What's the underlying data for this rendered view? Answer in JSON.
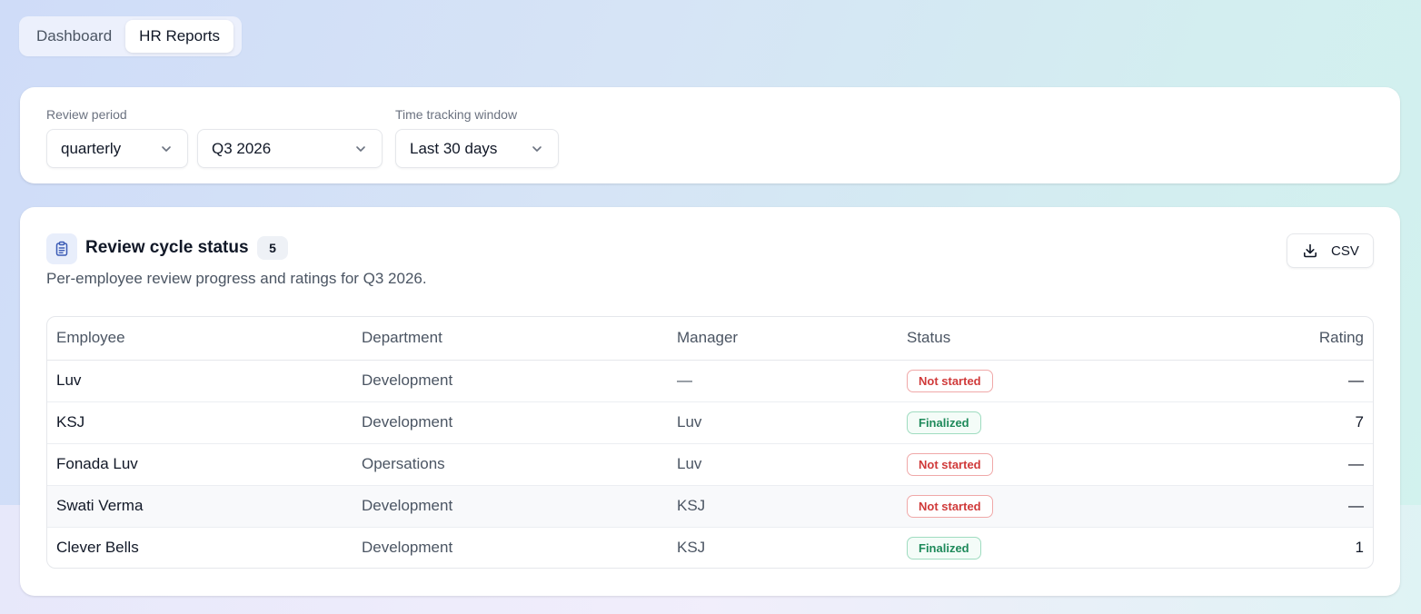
{
  "tabs": [
    {
      "label": "Dashboard",
      "active": false
    },
    {
      "label": "HR Reports",
      "active": true
    }
  ],
  "filters": {
    "review_period_label": "Review period",
    "period_type": "quarterly",
    "period_value": "Q3 2026",
    "time_window_label": "Time tracking window",
    "time_window": "Last 30 days"
  },
  "review_status": {
    "title": "Review cycle status",
    "count": "5",
    "subtitle": "Per-employee review progress and ratings for Q3 2026.",
    "csv_label": "CSV",
    "columns": {
      "employee": "Employee",
      "department": "Department",
      "manager": "Manager",
      "status": "Status",
      "rating": "Rating"
    },
    "rows": [
      {
        "employee": "Luv",
        "department": "Development",
        "manager": "—",
        "status": "Not started",
        "status_kind": "not",
        "rating": "—"
      },
      {
        "employee": "KSJ",
        "department": "Development",
        "manager": "Luv",
        "status": "Finalized",
        "status_kind": "fin",
        "rating": "7"
      },
      {
        "employee": "Fonada Luv",
        "department": "Opersations",
        "manager": "Luv",
        "status": "Not started",
        "status_kind": "not",
        "rating": "—"
      },
      {
        "employee": "Swati Verma",
        "department": "Development",
        "manager": "KSJ",
        "status": "Not started",
        "status_kind": "not",
        "rating": "—"
      },
      {
        "employee": "Clever Bells",
        "department": "Development",
        "manager": "KSJ",
        "status": "Finalized",
        "status_kind": "fin",
        "rating": "1"
      }
    ]
  },
  "colors": {
    "not_started": "#d03a3a",
    "finalized": "#1f8a5b",
    "icon_accent": "#3b5bb5"
  },
  "icons": {
    "review_icon": "clipboard-icon",
    "csv_icon": "download-icon",
    "select_icon": "chevron-down-icon"
  }
}
